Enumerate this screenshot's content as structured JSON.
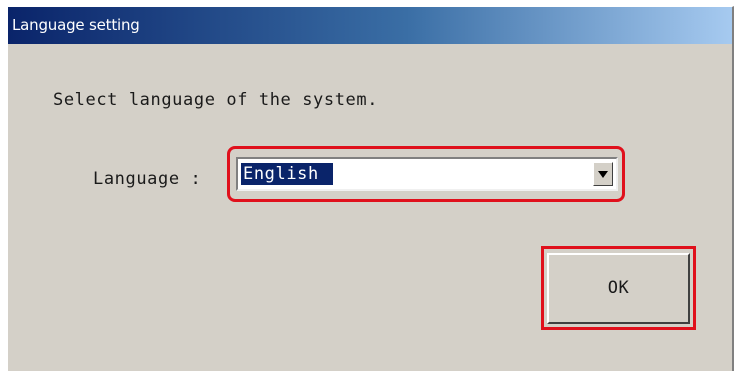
{
  "dialog": {
    "title": "Language setting",
    "prompt": "Select language of the system."
  },
  "language": {
    "label": "Language :",
    "selected": "English"
  },
  "buttons": {
    "ok_label": "OK"
  },
  "colors": {
    "title_gradient_start": "#0a246a",
    "title_gradient_end": "#a6caf0",
    "dialog_bg": "#d4d0c8",
    "selection_bg": "#0a246a",
    "highlight_outline": "#e0101c"
  }
}
